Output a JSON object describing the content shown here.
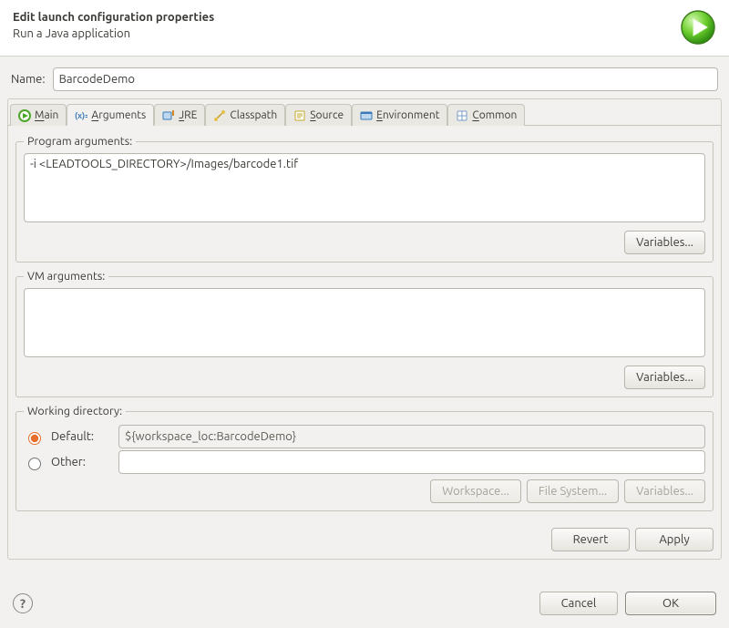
{
  "header": {
    "title": "Edit launch configuration properties",
    "subtitle": "Run a Java application"
  },
  "name": {
    "label": "Name:",
    "value": "BarcodeDemo"
  },
  "tabs": {
    "main": {
      "label": "Main",
      "mnemonic": "M"
    },
    "arguments": {
      "label": "Arguments",
      "mnemonic": "A"
    },
    "jre": {
      "label": "JRE",
      "mnemonic": "J"
    },
    "classpath": {
      "label": "Classpath",
      "mnemonic": ""
    },
    "source": {
      "label": "Source",
      "mnemonic": "S"
    },
    "environment": {
      "label": "Environment",
      "mnemonic": "E"
    },
    "common": {
      "label": "Common",
      "mnemonic": "C"
    }
  },
  "arguments": {
    "program_legend": "Program arguments:",
    "program_value": "-i <LEADTOOLS_DIRECTORY>/Images/barcode1.tif",
    "program_variables_btn": "Variables...",
    "vm_legend": "VM arguments:",
    "vm_value": "",
    "vm_variables_btn": "Variables...",
    "wd_legend": "Working directory:",
    "wd_default_label": "Default:",
    "wd_default_value": "${workspace_loc:BarcodeDemo}",
    "wd_other_label": "Other:",
    "wd_other_value": "",
    "wd_workspace_btn": "Workspace...",
    "wd_filesystem_btn": "File System...",
    "wd_variables_btn": "Variables..."
  },
  "panel_buttons": {
    "revert": "Revert",
    "apply": "Apply"
  },
  "footer": {
    "cancel": "Cancel",
    "ok": "OK"
  }
}
